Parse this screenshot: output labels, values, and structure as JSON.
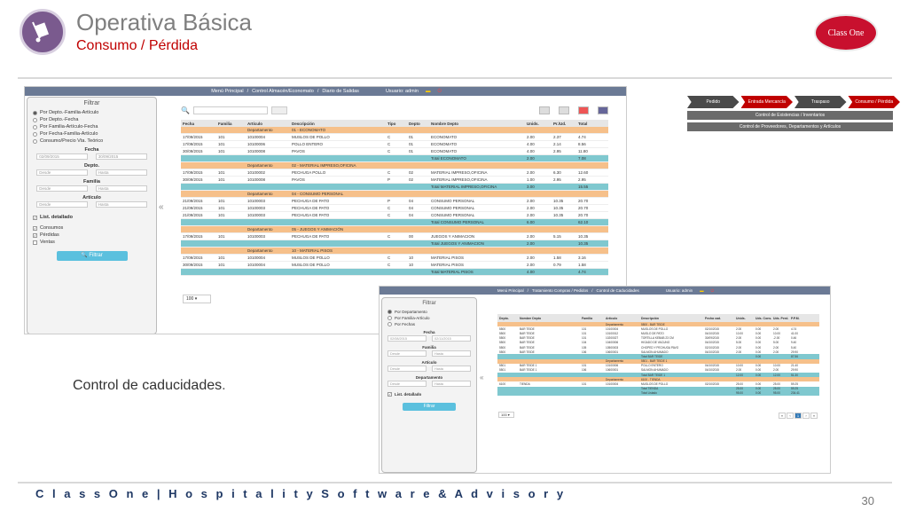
{
  "header": {
    "title": "Operativa Básica",
    "subtitle": "Consumo / Pérdida",
    "brand": "Class One"
  },
  "caption": "Control de caducidades",
  "caption_dot": ".",
  "footer": "C l a s s O n e | H o s p i t a l i t y S o f t w a r e & A d v i s o r y",
  "page_number": "30",
  "s1": {
    "menu": [
      "Menú Principal",
      "/",
      "Control Almacén/Economato",
      "/",
      "Diario de Salidas"
    ],
    "user": "Usuario: admin",
    "filter": {
      "title": "Filtrar",
      "options": [
        "Por Depto.-Familia-Artículo",
        "Por Depto.-Fecha",
        "Por Familia-Artículo-Fecha",
        "Por Fecha-Familia-Artículo",
        "Consumo/Precio Vta. Teórico"
      ],
      "fecha_label": "Fecha",
      "fecha_from": "02/09/2015",
      "fecha_to": "30/09/2015",
      "depto_label": "Depto.",
      "familia_label": "Familia",
      "articulo_label": "Artículo",
      "desde": "Desde",
      "hasta": "Hasta",
      "detalle": "List. detallado",
      "checks": [
        "Consumos",
        "Pérdidas",
        "Ventas"
      ],
      "button": "Filtrar"
    },
    "headers": [
      "Fecha",
      "Familia",
      "Artículo",
      "Descripción",
      "Tipo",
      "Depto",
      "Nombre Depto",
      "Unids.",
      "Pr./Ud.",
      "Total"
    ],
    "rows": [
      {
        "k": "dep",
        "c": [
          "",
          "",
          "Departamento",
          "01 - ECONOMATO",
          "",
          "",
          "",
          "",
          "",
          ""
        ]
      },
      {
        "k": "",
        "c": [
          "17/09/2015",
          "101",
          "10100004",
          "MUSLOS DE POLLO",
          "C",
          "01",
          "ECONOMATO",
          "2.00",
          "2.37",
          "4.74"
        ]
      },
      {
        "k": "",
        "c": [
          "17/09/2015",
          "101",
          "10100006",
          "POLLO ENTERO",
          "C",
          "01",
          "ECONOMATO",
          "4.00",
          "2.14",
          "8.56"
        ]
      },
      {
        "k": "",
        "c": [
          "30/09/2015",
          "101",
          "10100008",
          "PAVOS",
          "C",
          "01",
          "ECONOMATO",
          "4.00",
          "2.95",
          "11.80"
        ]
      },
      {
        "k": "tot",
        "c": [
          "",
          "",
          "",
          "",
          "",
          "",
          "Total ECONOMATO",
          "2.00",
          "",
          "7.08"
        ]
      },
      {
        "k": "dep",
        "c": [
          "",
          "",
          "Departamento",
          "02 - MATERIAL IMPRESO,OFICINA",
          "",
          "",
          "",
          "",
          "",
          ""
        ]
      },
      {
        "k": "",
        "c": [
          "17/09/2015",
          "101",
          "10100002",
          "PECHUGA POLLO",
          "C",
          "02",
          "MATERIAL IMPRESO,OFICINA",
          "2.00",
          "6.30",
          "12.60"
        ]
      },
      {
        "k": "",
        "c": [
          "30/09/2015",
          "101",
          "10100008",
          "PAVOS",
          "P",
          "02",
          "MATERIAL IMPRESO,OFICINA",
          "1.00",
          "2.95",
          "2.95"
        ]
      },
      {
        "k": "tot",
        "c": [
          "",
          "",
          "",
          "",
          "",
          "",
          "Total MATERIAL IMPRESO,OFICINA",
          "3.00",
          "",
          "15.55"
        ]
      },
      {
        "k": "dep",
        "c": [
          "",
          "",
          "Departamento",
          "04 - CONSUMO PERSONAL",
          "",
          "",
          "",
          "",
          "",
          ""
        ]
      },
      {
        "k": "",
        "c": [
          "21/09/2015",
          "101",
          "10100003",
          "PECHUGA DE PATO",
          "P",
          "04",
          "CONSUMO PERSONAL",
          "2.00",
          "10.35",
          "20.70"
        ]
      },
      {
        "k": "",
        "c": [
          "21/09/2015",
          "101",
          "10100003",
          "PECHUGA DE PATO",
          "C",
          "04",
          "CONSUMO PERSONAL",
          "2.00",
          "10.35",
          "20.70"
        ]
      },
      {
        "k": "",
        "c": [
          "21/09/2015",
          "101",
          "10100003",
          "PECHUGA DE PATO",
          "C",
          "04",
          "CONSUMO PERSONAL",
          "2.00",
          "10.35",
          "20.70"
        ]
      },
      {
        "k": "tot",
        "c": [
          "",
          "",
          "",
          "",
          "",
          "",
          "Total CONSUMO PERSONAL",
          "6.00",
          "",
          "62.10"
        ]
      },
      {
        "k": "dep",
        "c": [
          "",
          "",
          "Departamento",
          "05 - JUEGOS Y ANIMACIÓN",
          "",
          "",
          "",
          "",
          "",
          ""
        ]
      },
      {
        "k": "",
        "c": [
          "17/09/2015",
          "101",
          "10100003",
          "PECHUGA DE PATO",
          "C",
          "00",
          "JUEGOS Y ANIMACION",
          "2.00",
          "5.15",
          "10.35"
        ]
      },
      {
        "k": "tot",
        "c": [
          "",
          "",
          "",
          "",
          "",
          "",
          "Total JUEGOS Y ANIMACION",
          "2.00",
          "",
          "10.35"
        ]
      },
      {
        "k": "dep",
        "c": [
          "",
          "",
          "Departamento",
          "10 - MATERIAL PISOS",
          "",
          "",
          "",
          "",
          "",
          ""
        ]
      },
      {
        "k": "",
        "c": [
          "17/09/2015",
          "101",
          "10100004",
          "MUSLOS DE POLLO",
          "C",
          "10",
          "MATERIAL PISOS",
          "2.00",
          "1.58",
          "3.16"
        ]
      },
      {
        "k": "",
        "c": [
          "30/09/2015",
          "101",
          "10100004",
          "MUSLOS DE POLLO",
          "C",
          "10",
          "MATERIAL PISOS",
          "2.00",
          "0.79",
          "1.58"
        ]
      },
      {
        "k": "tot",
        "c": [
          "",
          "",
          "",
          "",
          "",
          "",
          "Total MATERIAL PISOS",
          "4.00",
          "",
          "4.74"
        ]
      }
    ],
    "pager": "100"
  },
  "process": {
    "steps": [
      "Pedido",
      "Entrada Mercancía",
      "Traspaso",
      "Consumo / Pérdida"
    ],
    "bars": [
      "Control de Existencias / Inventarios",
      "Control de Proveedores, Departamentos y Artículos"
    ]
  },
  "s2": {
    "menu": [
      "Menú Principal",
      "/",
      "Tratamiento Compras / Pedidos",
      "/",
      "Control de Caducidades"
    ],
    "user": "Usuario: admin",
    "filter": {
      "title": "Filtrar",
      "options": [
        "Por Departamento",
        "Por Familia-Artículo",
        "Por Fechas"
      ],
      "fecha_label": "Fecha",
      "fecha_from": "02/08/2015",
      "fecha_to": "02/11/2015",
      "familia_label": "Familia",
      "articulo_label": "Artículo",
      "depto_label": "Departamento",
      "desde": "Desde",
      "hasta": "Hasta",
      "detalle": "List. detallado",
      "button": "Filtrar"
    },
    "headers": [
      "Depto.",
      "Nombre Depto",
      "Familia",
      "Artículo",
      "Descripción",
      "Fecha cad.",
      "Unids.",
      "Uds. Cons.",
      "Uds. Perd.",
      "P.P.M."
    ],
    "rows": [
      {
        "k": "dep",
        "c": [
          "",
          "",
          "",
          "Departamento",
          "5500 - BAR TEIDE",
          "",
          "",
          "",
          "",
          ""
        ]
      },
      {
        "k": "",
        "c": [
          "5500",
          "BAR TEIDE",
          "101",
          "10100004",
          "MUSLOS DE POLLO",
          "02/10/2015",
          "2.00",
          "0.00",
          "2.00",
          "4.74"
        ]
      },
      {
        "k": "",
        "c": [
          "5500",
          "BAR TEIDE",
          "101",
          "10100012",
          "MUSLO DE PATO",
          "04/10/2015",
          "10.00",
          "0.00",
          "10.00",
          "41.00"
        ]
      },
      {
        "k": "",
        "c": [
          "5500",
          "BAR TEIDE",
          "101",
          "10200027",
          "TORTILLA KEBAB 23 CM",
          "30/09/2015",
          "2.00",
          "0.00",
          "-2.00",
          "0.46"
        ]
      },
      {
        "k": "",
        "c": [
          "5500",
          "BAR TEIDE",
          "104",
          "10400006",
          "HIGADO DE VACUNO",
          "04/10/2015",
          "5.00",
          "0.00",
          "5.00",
          "9.40"
        ]
      },
      {
        "k": "",
        "c": [
          "5500",
          "BAR TEIDE",
          "105",
          "10500003",
          "CHOPED Y PECHUGA PAVO",
          "02/10/2015",
          "2.00",
          "0.00",
          "2.00",
          "5.40"
        ]
      },
      {
        "k": "",
        "c": [
          "5500",
          "BAR TEIDE",
          "106",
          "10600001",
          "SALMON AHUMADO",
          "04/10/2015",
          "2.00",
          "0.00",
          "2.00",
          "29.90"
        ]
      },
      {
        "k": "tot",
        "c": [
          "",
          "",
          "",
          "",
          "Total BAR TEIDE",
          "",
          "",
          "0.00",
          "",
          "87.56"
        ]
      },
      {
        "k": "dep",
        "c": [
          "",
          "",
          "",
          "Departamento",
          "5501 - BAR TEIDE 1",
          "",
          "",
          "",
          "",
          ""
        ]
      },
      {
        "k": "",
        "c": [
          "5501",
          "BAR TEIDE 1",
          "101",
          "10100006",
          "POLLO ENTERO",
          "04/10/2015",
          "10.00",
          "0.00",
          "10.00",
          "21.40"
        ]
      },
      {
        "k": "",
        "c": [
          "5501",
          "BAR TEIDE 1",
          "106",
          "10600001",
          "SALMON AHUMADO",
          "04/10/2015",
          "2.00",
          "0.00",
          "2.00",
          "29.90"
        ]
      },
      {
        "k": "tot",
        "c": [
          "",
          "",
          "",
          "",
          "Total BAR TEIDE 1",
          "",
          "12.00",
          "0.00",
          "12.00",
          "51.30"
        ]
      },
      {
        "k": "dep",
        "c": [
          "",
          "",
          "",
          "Departamento",
          "6100 - TIENDA",
          "",
          "",
          "",
          "",
          ""
        ]
      },
      {
        "k": "",
        "c": [
          "6100",
          "TIENDA",
          "101",
          "10100004",
          "MUSLOS DE POLLO",
          "02/10/2015",
          "25.00",
          "0.00",
          "25.00",
          "59.25"
        ]
      },
      {
        "k": "tot",
        "c": [
          "",
          "",
          "",
          "",
          "Total TIENDA",
          "",
          "25.00",
          "0.00",
          "25.00",
          "59.25"
        ]
      },
      {
        "k": "tot",
        "c": [
          "",
          "",
          "",
          "",
          "Total Listado",
          "",
          "95.00",
          "0.00",
          "95.00",
          "234.41"
        ]
      }
    ],
    "pager": "100",
    "pages": [
      "«",
      "‹",
      "1",
      "›",
      "»"
    ]
  }
}
